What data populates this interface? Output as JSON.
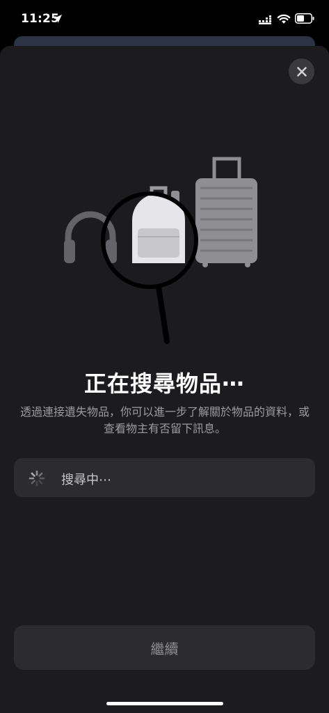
{
  "status_bar": {
    "time": "11:25",
    "icons": [
      "location-arrow-icon",
      "cellular-signal-icon",
      "wifi-icon",
      "battery-icon"
    ]
  },
  "sheet": {
    "close_icon": "close-icon",
    "illustration_icons": [
      "headphones-icon",
      "backpack-icon",
      "magnifying-glass-icon",
      "suitcase-icon"
    ],
    "title": "正在搜尋物品⋯",
    "description": "透過連接遺失物品，你可以進一步了解關於物品的資料，或查看物主有否留下訊息。",
    "search_status": {
      "icon": "activity-spinner-icon",
      "label": "搜尋中⋯"
    },
    "continue_label": "繼續"
  },
  "colors": {
    "background": "#000000",
    "sheet": "#1c1c1e",
    "row": "#2c2c2e",
    "muted_text": "#9c9ca1"
  }
}
